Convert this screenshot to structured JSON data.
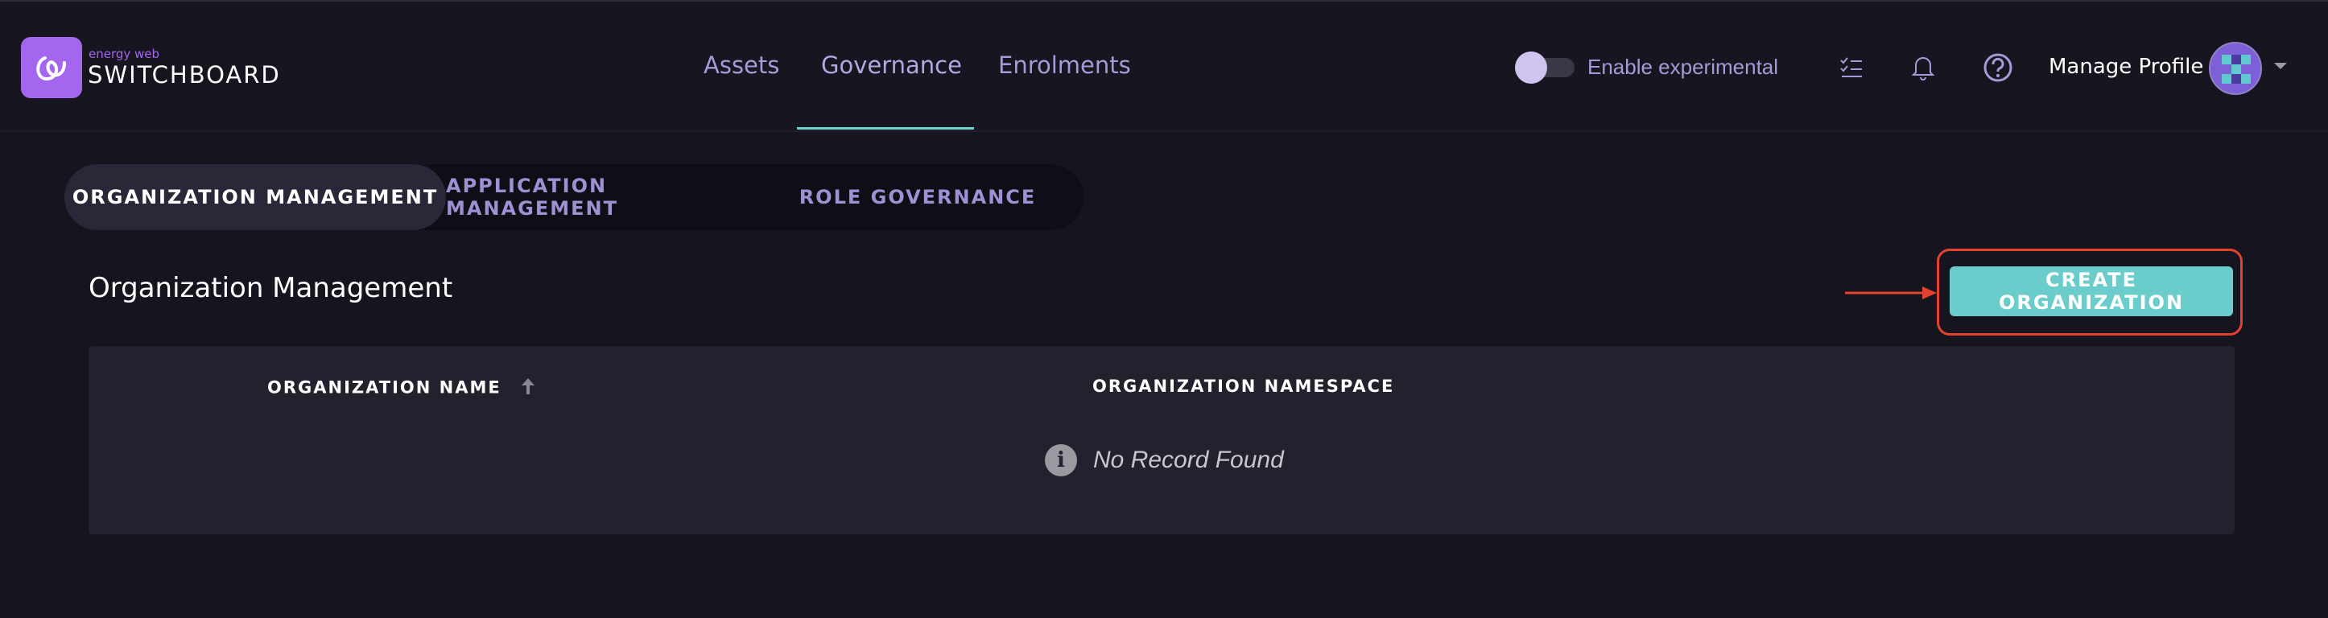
{
  "brand": {
    "sub": "energy web",
    "name": "SWITCHBOARD",
    "color": "#a466ee"
  },
  "nav": {
    "assets": "Assets",
    "governance": "Governance",
    "enrolments": "Enrolments",
    "active": "Governance"
  },
  "experimental": {
    "label": "Enable experimental",
    "enabled": false
  },
  "header_icons": [
    "checklist-icon",
    "bell-icon",
    "help-icon"
  ],
  "profile": {
    "label": "Manage Profile"
  },
  "tabs": [
    {
      "label": "ORGANIZATION MANAGEMENT",
      "active": true
    },
    {
      "label": "APPLICATION MANAGEMENT",
      "active": false
    },
    {
      "label": "ROLE GOVERNANCE",
      "active": false
    }
  ],
  "section": {
    "title": "Organization Management",
    "create_button": "CREATE ORGANIZATION"
  },
  "table": {
    "columns": [
      "ORGANIZATION NAME",
      "ORGANIZATION NAMESPACE"
    ],
    "sort_column": "ORGANIZATION NAME",
    "sort_direction": "ascending",
    "empty_message": "No Record Found"
  },
  "colors": {
    "accent": "#6bcdcb",
    "annotation": "#e2432e",
    "background": "#16141f"
  }
}
